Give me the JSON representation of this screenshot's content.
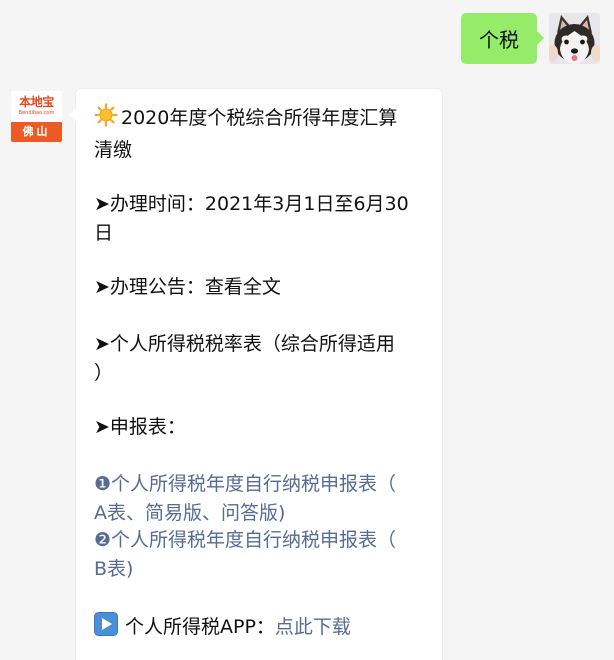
{
  "outgoing": {
    "text": "个税"
  },
  "bot": {
    "logo_brand": "本地宝",
    "logo_site": "Bendibao.com",
    "logo_city": "佛山"
  },
  "message": {
    "title_line1": "2020年度个税综合所得年度汇算",
    "title_line2": "清缴",
    "time_line1": "➤办理时间：2021年3月1日至6月30",
    "time_line2": "日",
    "notice_prefix": "➤办理公告：",
    "notice_link": "查看全文",
    "rate_line1": "➤个人所得税税率表（综合所得适用",
    "rate_line2": "）",
    "form_heading": "➤申报表：",
    "form_a_line1": "❶个人所得税年度自行纳税申报表（",
    "form_a_line2": "A表、简易版、问答版)",
    "form_b_line1": "❷个人所得税年度自行纳税申报表（",
    "form_b_line2": "B表)",
    "app_prefix": "个人所得税APP：",
    "app_link": "点此下载"
  },
  "colors": {
    "background": "#f5f5f5",
    "outgoing_bubble": "#95ec69",
    "link": "#576b95",
    "brand_orange": "#ee5a24"
  },
  "icons": {
    "sun": "sun-emoji-icon",
    "play": "play-button-emoji-icon"
  }
}
